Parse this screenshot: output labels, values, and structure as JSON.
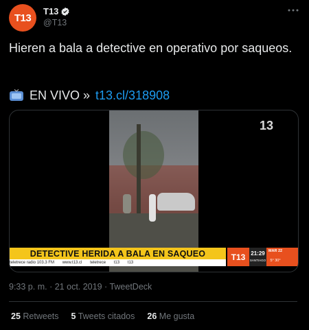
{
  "author": {
    "display_name": "T13",
    "handle": "@T13",
    "avatar_text": "T13",
    "verified": true
  },
  "tweet": {
    "text": "Hieren a bala a detective en operativo por saqueos.",
    "live_label": "EN VIVO »",
    "link": "t13.cl/318908"
  },
  "media": {
    "channel_logo": "13",
    "headline": "DETECTIVE HERIDA A BALA EN SAQUEO",
    "ticker_items": [
      "teletrece radio 103.3 FM",
      "www.t13.cl",
      "teletrece",
      "t13",
      "t13"
    ],
    "brand": "T13",
    "time": "21:29",
    "city": "SANTIAGO",
    "weather_date": "MAR 22",
    "weather_temp": "5° 30°"
  },
  "meta": {
    "time": "9:33 p. m.",
    "date": "21 oct. 2019",
    "source": "TweetDeck",
    "separator": "·"
  },
  "stats": {
    "retweets_count": "25",
    "retweets_label": "Retweets",
    "quotes_count": "5",
    "quotes_label": "Tweets citados",
    "likes_count": "26",
    "likes_label": "Me gusta"
  },
  "colors": {
    "accent": "#1d9bf0",
    "brand": "#e8501e",
    "headline_bg": "#f4c51b"
  }
}
